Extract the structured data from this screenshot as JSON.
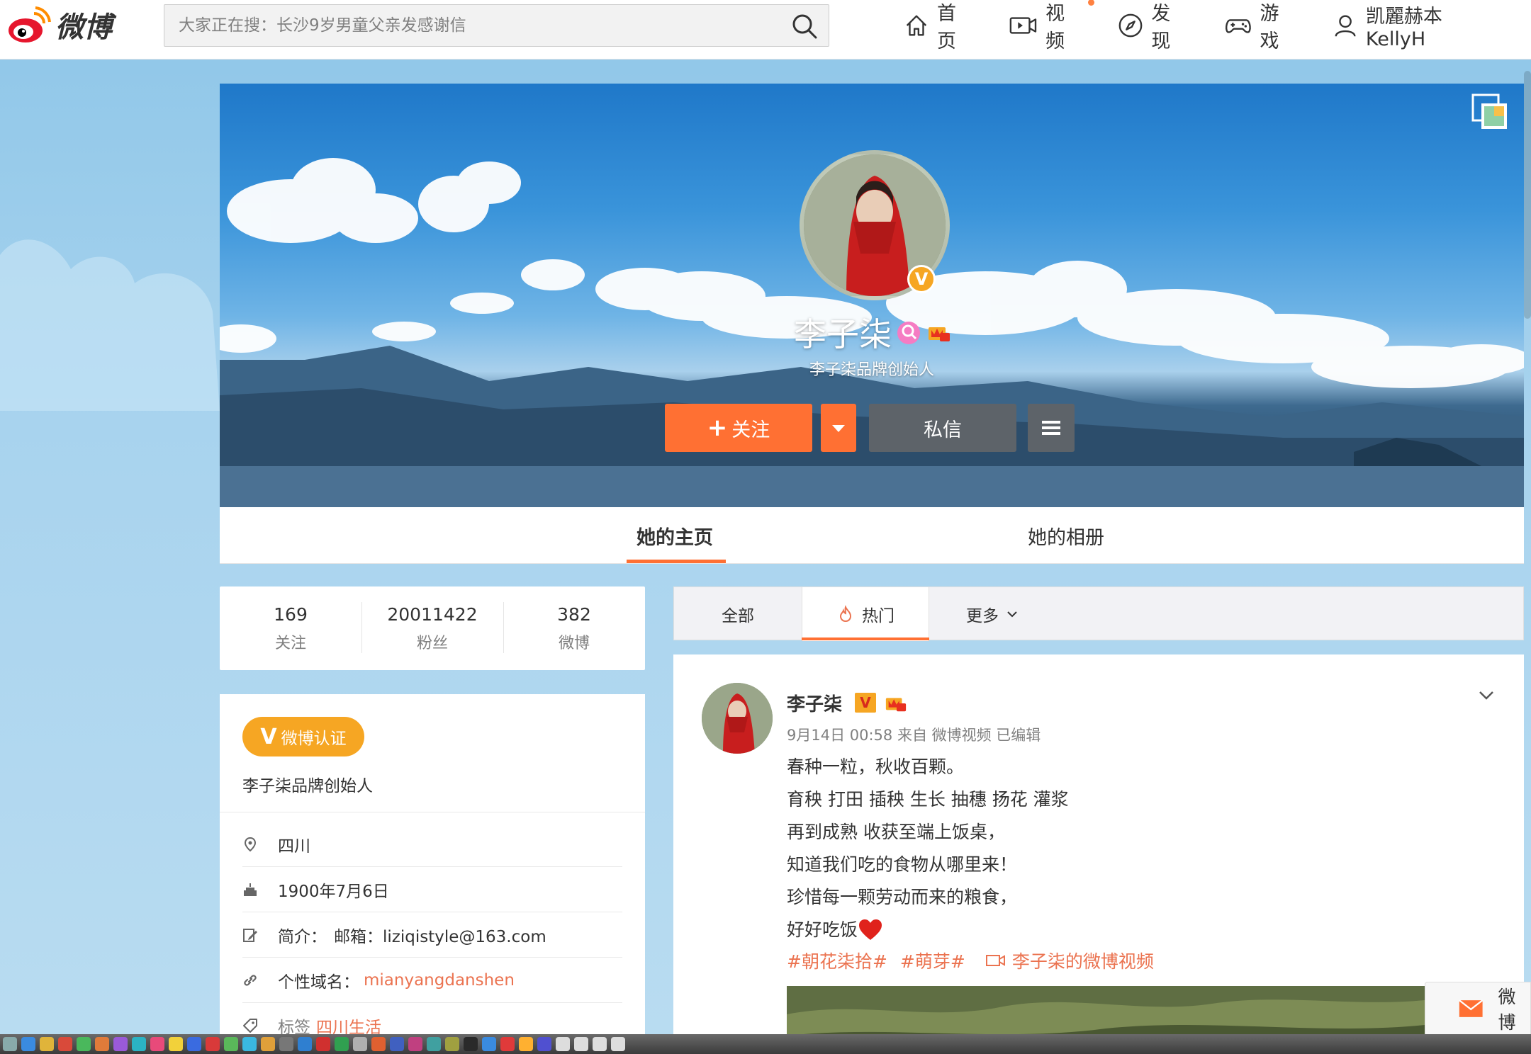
{
  "header": {
    "logo_text": "微博",
    "search_placeholder": "大家正在搜：长沙9岁男童父亲发感谢信",
    "nav": [
      {
        "label": "首页",
        "icon": "home-icon"
      },
      {
        "label": "视频",
        "icon": "video-icon",
        "has_dot": true
      },
      {
        "label": "发现",
        "icon": "compass-icon"
      },
      {
        "label": "游戏",
        "icon": "gamepad-icon"
      },
      {
        "label": "凯麗赫本KellyH",
        "icon": "user-icon"
      }
    ]
  },
  "profile": {
    "name": "李子柒",
    "description": "李子柒品牌创始人",
    "verified_mark": "V",
    "follow_label": "关注",
    "follow_plus": "+",
    "message_label": "私信"
  },
  "tabs": {
    "home": "她的主页",
    "album": "她的相册"
  },
  "stats": [
    {
      "value": "169",
      "label": "关注"
    },
    {
      "value": "20011422",
      "label": "粉丝"
    },
    {
      "value": "382",
      "label": "微博"
    }
  ],
  "info": {
    "cert_mark": "V",
    "cert_label": "微博认证",
    "cert_text": "李子柒品牌创始人",
    "location": "四川",
    "birthday": "1900年7月6日",
    "bio_prefix": "简介：",
    "bio": "邮箱：liziqistyle@163.com",
    "domain_label": "个性域名：",
    "domain_value": "mianyangdanshen",
    "tags_label": "标签",
    "tags_value": "四川生活"
  },
  "feed_tabs": {
    "all": "全部",
    "hot": "热门",
    "more": "更多"
  },
  "post": {
    "author": "李子柒",
    "verified_mark": "V",
    "meta": "9月14日 00:58 来自 微博视频   已编辑",
    "lines": [
      "春种一粒，秋收百颗。",
      "育秧 打田 插秧 生长 抽穗 扬花 灌浆",
      "再到成熟 收获至端上饭桌，",
      "知道我们吃的食物从哪里来！",
      "珍惜每一颗劳动而来的粮食，",
      "好好吃饭"
    ],
    "tags": [
      "#朝花柒拾#",
      "#萌芽#"
    ],
    "video_link": "李子柒的微博视频"
  },
  "floating": {
    "label": "微博"
  },
  "colors": {
    "accent": "#ff7033",
    "link": "#eb7350",
    "gold": "#f6a623"
  }
}
